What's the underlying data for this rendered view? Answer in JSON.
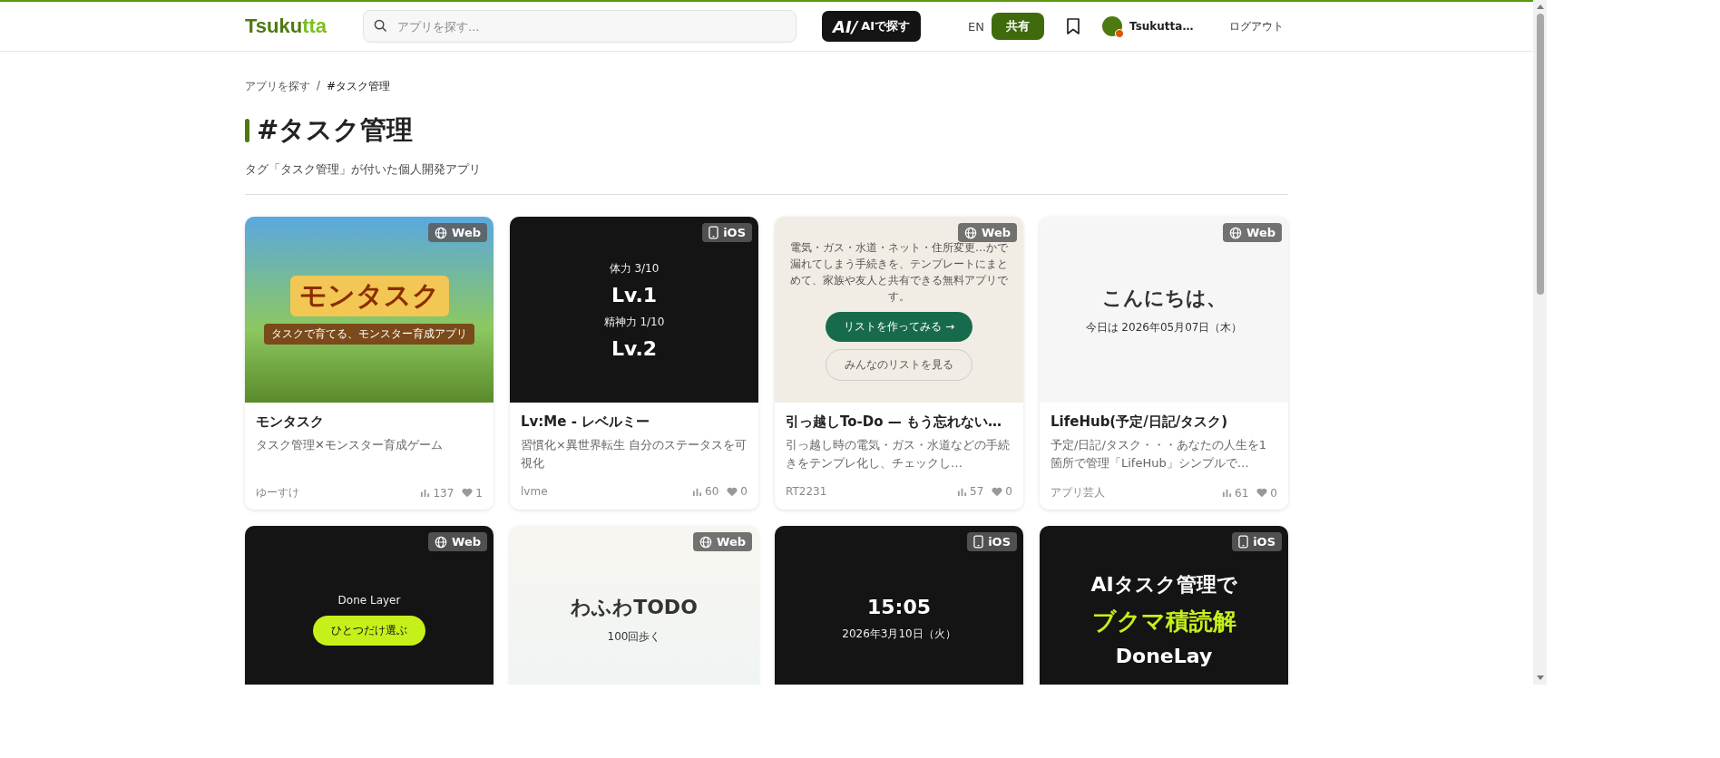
{
  "header": {
    "logo": {
      "part_1": "Tsuku",
      "part_2": "tta"
    },
    "search": {
      "placeholder": "アプリを探す..."
    },
    "ai_button": {
      "mark": "AI/",
      "label": "AIで探す"
    },
    "language": "EN",
    "share_button": "共有",
    "user_name": "Tsukutta…",
    "logout": "ログアウト"
  },
  "breadcrumb": [
    {
      "label": "アプリを探す"
    },
    {
      "label": "#タスク管理"
    }
  ],
  "breadcrumb_separator": "/",
  "title": "#タスク管理",
  "subtitle": "タグ「タスク管理」が付いた個人開発アプリ",
  "cards": [
    {
      "platform": "Web",
      "title": "モンタスク",
      "description": "タスク管理✕モンスター育成ゲーム",
      "author": "ゆーすけ",
      "views": "137",
      "likes": "1",
      "thumb": {
        "kind": "game",
        "lines": [
          {
            "kind": "big",
            "text": "モンタスク"
          },
          {
            "kind": "banner",
            "text": "タスクで育てる、モンスター育成アプリ"
          }
        ]
      }
    },
    {
      "platform": "iOS",
      "title": "Lv:Me - レベルミー",
      "description": "習慣化×異世界転生 自分のステータスを可視化",
      "author": "lvme",
      "views": "60",
      "likes": "0",
      "thumb": {
        "kind": "dark",
        "lines": [
          {
            "kind": "small",
            "text": "体力 3/10"
          },
          {
            "kind": "big",
            "text": "Lv.1"
          },
          {
            "kind": "small",
            "text": "精神力 1/10"
          },
          {
            "kind": "big",
            "text": "Lv.2"
          }
        ]
      }
    },
    {
      "platform": "Web",
      "title": "引っ越しTo-Do — もう忘れない…",
      "description": "引っ越し時の電気・ガス・水道などの手続きをテンプレ化し、チェックし…",
      "author": "RT2231",
      "views": "57",
      "likes": "0",
      "thumb": {
        "kind": "cream",
        "lines": [
          {
            "kind": "small",
            "text": "電気・ガス・水道・ネット・住所変更…かで漏れてしまう手続きを、テンプレートにまとめて、家族や友人と共有できる無料アプリです。"
          },
          {
            "kind": "button",
            "text": "リストを作ってみる →"
          },
          {
            "kind": "outline",
            "text": "みんなのリストを見る"
          }
        ]
      }
    },
    {
      "platform": "Web",
      "title": "LifeHub(予定/日記/タスク)",
      "description": "予定/日記/タスク・・・あなたの人生を1箇所で管理「LifeHub」シンプルで…",
      "author": "アプリ芸人",
      "views": "61",
      "likes": "0",
      "thumb": {
        "kind": "light",
        "lines": [
          {
            "kind": "big",
            "text": "こんにちは、"
          },
          {
            "kind": "small",
            "text": "今日は 2026年05月07日（木）"
          }
        ]
      }
    },
    {
      "platform": "Web",
      "thumb": {
        "kind": "dark",
        "lines": [
          {
            "kind": "small",
            "text": "Done Layer"
          },
          {
            "kind": "button",
            "text": "ひとつだけ選ぶ"
          }
        ]
      }
    },
    {
      "platform": "Web",
      "thumb": {
        "kind": "pastel",
        "lines": [
          {
            "kind": "big",
            "text": "わふわTODO"
          },
          {
            "kind": "small",
            "text": "100回歩く"
          }
        ]
      }
    },
    {
      "platform": "iOS",
      "thumb": {
        "kind": "dark",
        "lines": [
          {
            "kind": "big",
            "text": "15:05"
          },
          {
            "kind": "small",
            "text": "2026年3月10日（火）"
          }
        ]
      }
    },
    {
      "platform": "iOS",
      "thumb": {
        "kind": "dark",
        "lines": [
          {
            "kind": "big",
            "text": "AIタスク管理で"
          },
          {
            "kind": "accent",
            "text": "ブクマ積読解"
          },
          {
            "kind": "big",
            "text": "DoneLay"
          }
        ]
      }
    }
  ]
}
